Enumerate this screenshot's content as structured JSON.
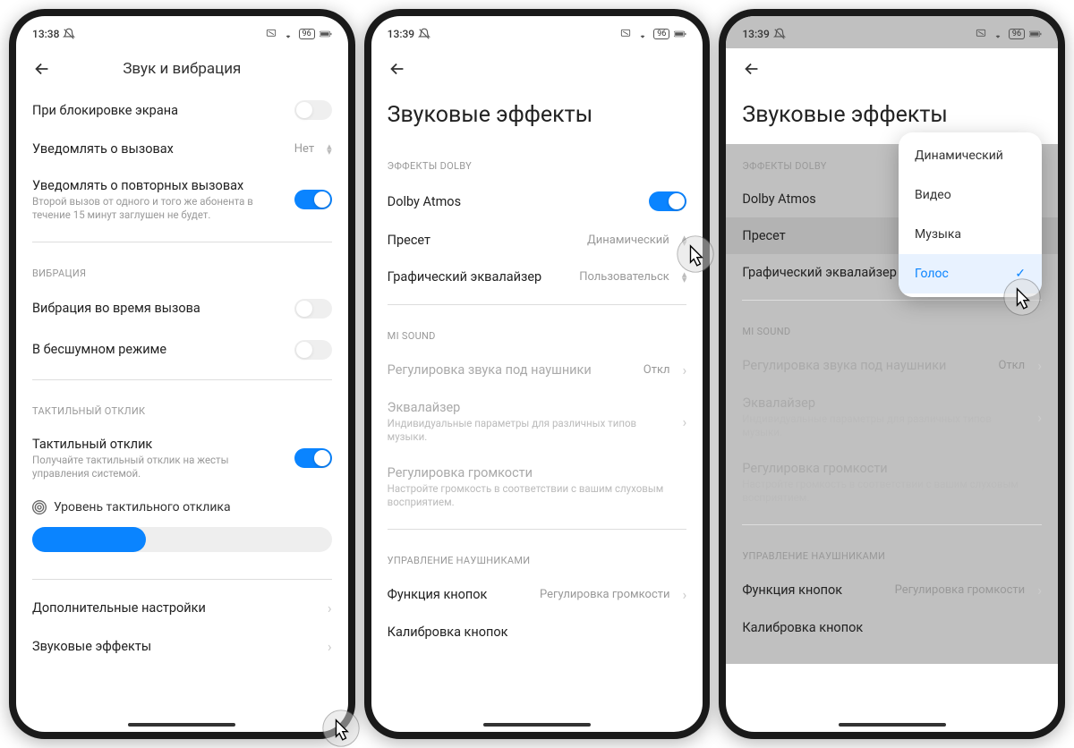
{
  "statusbar": {
    "time1": "13:38",
    "time2": "13:39",
    "time3": "13:39",
    "battery": "96"
  },
  "s1": {
    "title": "Звук и вибрация",
    "row_lock": "При блокировке экрана",
    "row_calls": "Уведомлять о вызовах",
    "row_calls_val": "Нет",
    "row_repeat": "Уведомлять о повторных вызовах",
    "row_repeat_sub": "Второй вызов от одного и того же абонента в течение 15 минут заглушен не будет.",
    "sec_vibration": "ВИБРАЦИЯ",
    "row_vib_call": "Вибрация во время вызова",
    "row_vib_silent": "В бесшумном режиме",
    "sec_haptic": "ТАКТИЛЬНЫЙ ОТКЛИК",
    "row_haptic": "Тактильный отклик",
    "row_haptic_sub": "Получайте тактильный отклик на жесты управления системой.",
    "row_haptic_level": "Уровень тактильного отклика",
    "row_more": "Дополнительные настройки",
    "row_effects": "Звуковые эффекты"
  },
  "s2": {
    "title": "Звуковые эффекты",
    "sec_dolby": "ЭФФЕКТЫ DOLBY",
    "row_atmos": "Dolby Atmos",
    "row_preset": "Пресет",
    "row_preset_val": "Динамический",
    "row_eq": "Графический эквалайзер",
    "row_eq_val": "Пользовательск",
    "sec_misound": "MI SOUND",
    "row_headphone": "Регулировка звука под наушники",
    "row_headphone_val": "Откл",
    "row_equalizer": "Эквалайзер",
    "row_equalizer_sub": "Индивидуальные параметры для различных типов музыки.",
    "row_volume": "Регулировка громкости",
    "row_volume_sub": "Настройте громкость в соответствии с вашим слуховым восприятием.",
    "sec_headphones": "УПРАВЛЕНИЕ НАУШНИКАМИ",
    "row_buttons": "Функция кнопок",
    "row_buttons_val": "Регулировка громкости",
    "row_calib": "Калибровка кнопок"
  },
  "popup": {
    "opt1": "Динамический",
    "opt2": "Видео",
    "opt3": "Музыка",
    "opt4": "Голос"
  }
}
